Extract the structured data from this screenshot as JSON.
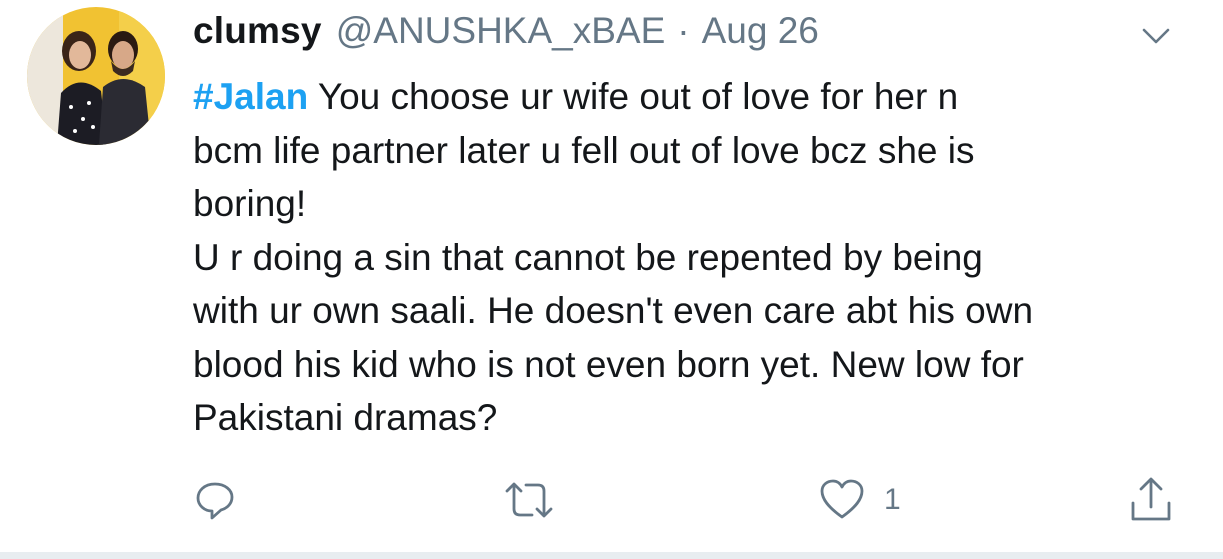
{
  "tweet": {
    "author_name": "clumsy",
    "author_handle": "@ANUSHKA_xBAE",
    "separator": "·",
    "date": "Aug 26",
    "hashtag": "#Jalan",
    "line1_rest": " You choose ur wife out of love for her n",
    "line2": "bcm life partner later u fell out of love bcz she is",
    "line3": "boring!",
    "line4": "U r doing a sin that cannot be repented by being",
    "line5": "with ur own saali. He doesn't even care abt his own",
    "line6": "blood his kid who is not even born yet. New low for",
    "line7": "Pakistani dramas?"
  },
  "actions": {
    "reply_icon": "reply-icon",
    "retweet_icon": "retweet-icon",
    "like_icon": "heart-icon",
    "like_count": "1",
    "share_icon": "share-icon"
  },
  "colors": {
    "text": "#14171a",
    "secondary": "#657786",
    "link": "#1da1f2",
    "divider": "#e8edf0"
  }
}
